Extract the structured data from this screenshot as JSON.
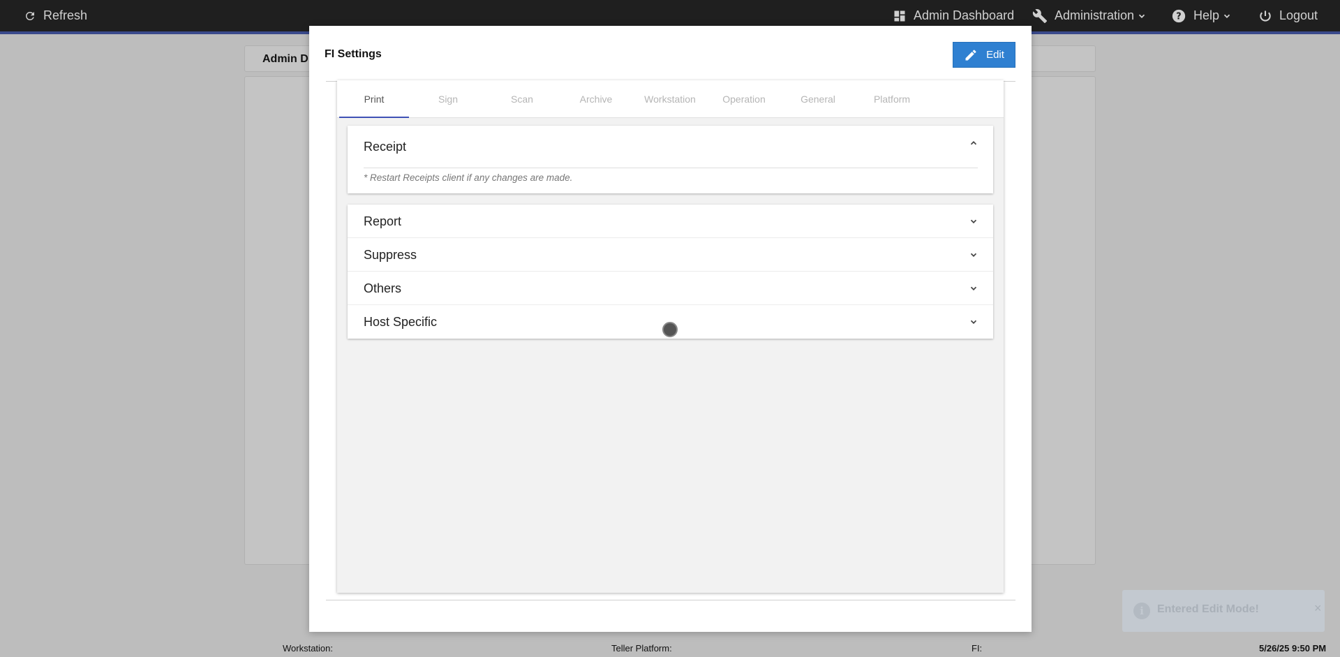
{
  "topbar": {
    "refresh_label": "Refresh",
    "admin_dashboard_label": "Admin Dashboard",
    "administration_label": "Administration",
    "help_label": "Help",
    "logout_label": "Logout"
  },
  "background": {
    "card_title": "Admin D"
  },
  "modal": {
    "title": "FI Settings",
    "edit_label": "Edit",
    "tabs": [
      {
        "label": "Print",
        "active": true
      },
      {
        "label": "Sign"
      },
      {
        "label": "Scan"
      },
      {
        "label": "Archive"
      },
      {
        "label": "Workstation"
      },
      {
        "label": "Operation"
      },
      {
        "label": "General"
      },
      {
        "label": "Platform"
      }
    ],
    "receipt": {
      "label": "Receipt",
      "note": "* Restart Receipts client if any changes are made."
    },
    "sections": [
      {
        "label": "Report"
      },
      {
        "label": "Suppress"
      },
      {
        "label": "Others"
      },
      {
        "label": "Host Specific"
      }
    ]
  },
  "toast": {
    "message": "Entered Edit Mode!",
    "close": "×"
  },
  "footer": {
    "workstation_label": "Workstation:",
    "teller_platform_label": "Teller Platform:",
    "fi_label": "FI:",
    "datetime": "5/26/25 9:50 PM"
  },
  "colors": {
    "topbar_bg": "#1f1f1f",
    "accent": "#3f51b5",
    "edit_button": "#2f80d1"
  },
  "icons": {
    "refresh": "refresh-icon",
    "dashboard": "dashboard-icon",
    "wrench": "wrench-icon",
    "help": "help-circle-icon",
    "power": "power-icon",
    "pencil": "pencil-icon",
    "chevron_up": "chevron-up-icon",
    "chevron_down": "chevron-down-icon",
    "info": "info-icon"
  }
}
